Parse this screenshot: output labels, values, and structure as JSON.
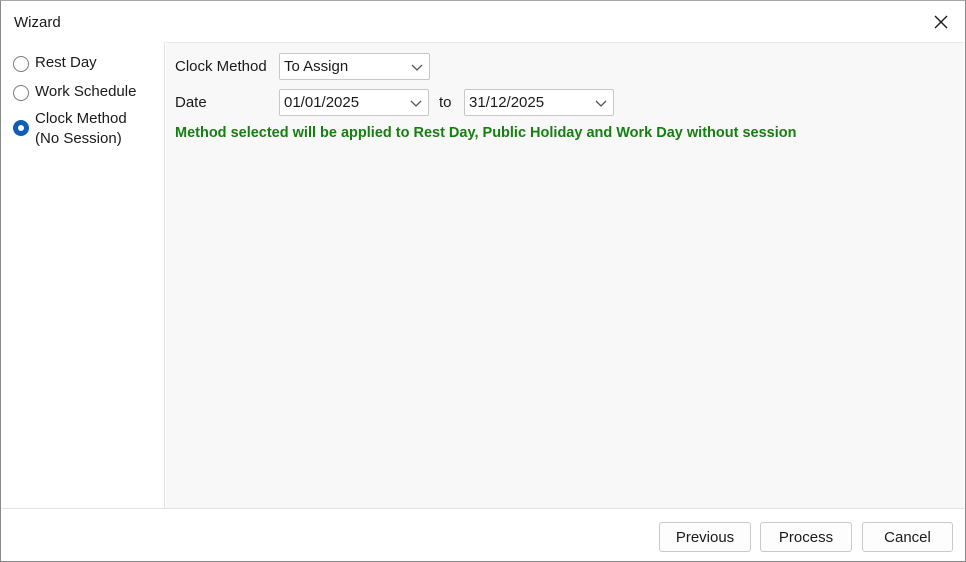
{
  "window": {
    "title": "Wizard"
  },
  "sidebar": {
    "items": [
      {
        "label": "Rest Day",
        "label2": "",
        "checked": false
      },
      {
        "label": "Work Schedule",
        "label2": "",
        "checked": false
      },
      {
        "label": "Clock Method",
        "label2": "(No Session)",
        "checked": true
      }
    ]
  },
  "form": {
    "clock_method_label": "Clock Method",
    "clock_method_value": "To Assign",
    "date_label": "Date",
    "date_from": "01/01/2025",
    "to_label": "to",
    "date_to": "31/12/2025",
    "notice": "Method selected will be applied to Rest Day, Public Holiday and Work Day without session"
  },
  "footer": {
    "previous_label": "Previous",
    "process_label": "Process",
    "cancel_label": "Cancel"
  },
  "colors": {
    "accent": "#0f5db5",
    "notice": "#157f0f"
  },
  "icons": {
    "close": "close-icon",
    "dropdown": "chevron-down-icon"
  }
}
